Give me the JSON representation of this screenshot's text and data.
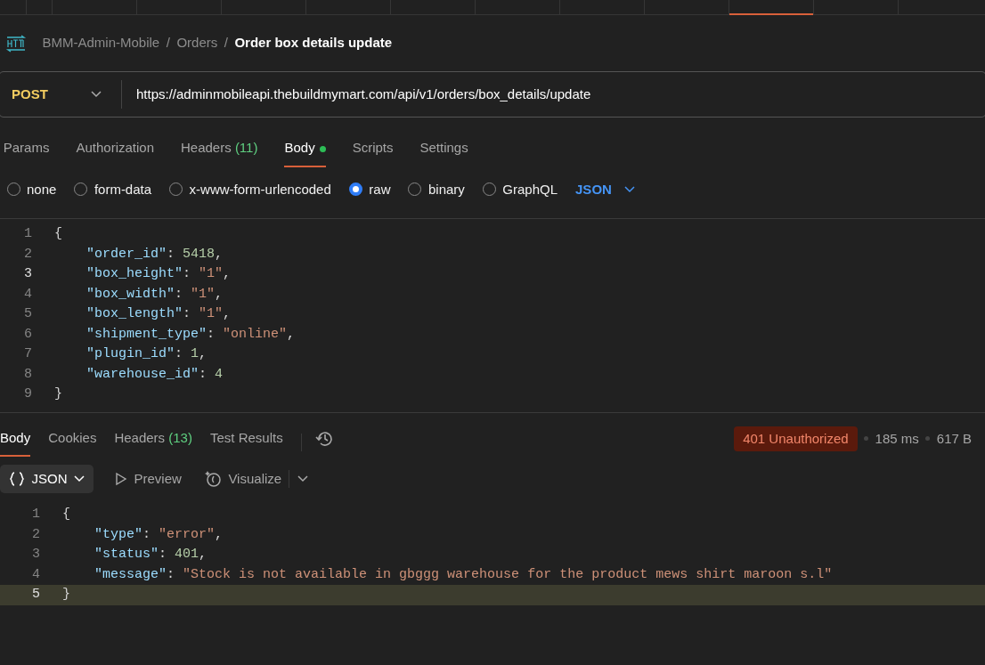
{
  "top_tabs": [
    {
      "selected": false
    },
    {
      "selected": false
    },
    {
      "selected": false
    },
    {
      "selected": false
    },
    {
      "selected": false
    },
    {
      "selected": false
    },
    {
      "selected": false
    },
    {
      "selected": false
    },
    {
      "selected": false
    },
    {
      "selected": false
    },
    {
      "selected": true
    },
    {
      "selected": false
    }
  ],
  "breadcrumb": {
    "items": [
      "BMM-Admin-Mobile",
      "Orders",
      "Order box details update"
    ],
    "separator": "/"
  },
  "request": {
    "method": "POST",
    "url": "https://adminmobileapi.thebuildmymart.com/api/v1/orders/box_details/update"
  },
  "request_tabs": [
    {
      "label": "Params",
      "selected": false
    },
    {
      "label": "Authorization",
      "selected": false
    },
    {
      "label": "Headers",
      "count": "(11)",
      "selected": false
    },
    {
      "label": "Body",
      "dot": true,
      "selected": true
    },
    {
      "label": "Scripts",
      "selected": false
    },
    {
      "label": "Settings",
      "selected": false
    }
  ],
  "body_types": [
    {
      "label": "none",
      "selected": false
    },
    {
      "label": "form-data",
      "selected": false
    },
    {
      "label": "x-www-form-urlencoded",
      "selected": false
    },
    {
      "label": "raw",
      "selected": true
    },
    {
      "label": "binary",
      "selected": false
    },
    {
      "label": "GraphQL",
      "selected": false
    }
  ],
  "raw_format": "JSON",
  "request_body": [
    {
      "number": "1",
      "text": "{",
      "current": false
    },
    {
      "number": "2",
      "text": "    \"order_id\": 5418,",
      "current": false
    },
    {
      "number": "3",
      "text": "    \"box_height\": \"1\",",
      "current": true
    },
    {
      "number": "4",
      "text": "    \"box_width\": \"1\",",
      "current": false
    },
    {
      "number": "5",
      "text": "    \"box_length\": \"1\",",
      "current": false
    },
    {
      "number": "6",
      "text": "    \"shipment_type\": \"online\",",
      "current": false
    },
    {
      "number": "7",
      "text": "    \"plugin_id\": 1,",
      "current": false
    },
    {
      "number": "8",
      "text": "    \"warehouse_id\": 4",
      "current": false
    },
    {
      "number": "9",
      "text": "}",
      "current": false
    }
  ],
  "response_tabs": [
    {
      "label": "Body",
      "selected": true
    },
    {
      "label": "Cookies",
      "selected": false
    },
    {
      "label": "Headers",
      "count": "(13)",
      "selected": false
    },
    {
      "label": "Test Results",
      "selected": false
    }
  ],
  "response_status": {
    "status": "401 Unauthorized",
    "time": "185 ms",
    "size": "617 B"
  },
  "response_toolbar": {
    "format": "JSON",
    "preview": "Preview",
    "visualize": "Visualize"
  },
  "response_body": [
    {
      "number": "1",
      "text": "{",
      "current": false
    },
    {
      "number": "2",
      "text": "    \"type\": \"error\",",
      "current": false
    },
    {
      "number": "3",
      "text": "    \"status\": 401,",
      "current": false
    },
    {
      "number": "4",
      "text": "    \"message\": \"Stock is not available in gbggg warehouse for the product mews shirt maroon s.l\"",
      "current": false
    },
    {
      "number": "5",
      "text": "}",
      "current": true
    }
  ]
}
